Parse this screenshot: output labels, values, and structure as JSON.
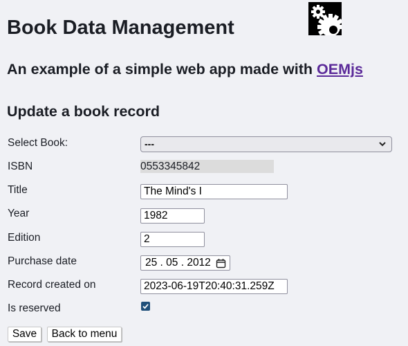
{
  "header": {
    "title": "Book Data Management",
    "logo_icon": "gears-icon",
    "subtitle_prefix": "An example of a simple web app made with ",
    "subtitle_link": "OEMjs"
  },
  "form": {
    "heading": "Update a book record",
    "select_book": {
      "label": "Select Book:",
      "value": "---"
    },
    "isbn": {
      "label": "ISBN",
      "value": "0553345842"
    },
    "title": {
      "label": "Title",
      "value": "The Mind's I"
    },
    "year": {
      "label": "Year",
      "value": "1982"
    },
    "edition": {
      "label": "Edition",
      "value": "2"
    },
    "purchase_date": {
      "label": "Purchase date",
      "value": "25 . 05 . 2012"
    },
    "record_created": {
      "label": "Record created on",
      "value": "2023-06-19T20:40:31.259Z"
    },
    "is_reserved": {
      "label": "Is reserved",
      "checked": true
    }
  },
  "buttons": {
    "save": "Save",
    "back": "Back to menu"
  },
  "colors": {
    "link": "#5b2a99",
    "checkbox": "#1f4f7a",
    "background": "#f0f1f5"
  }
}
